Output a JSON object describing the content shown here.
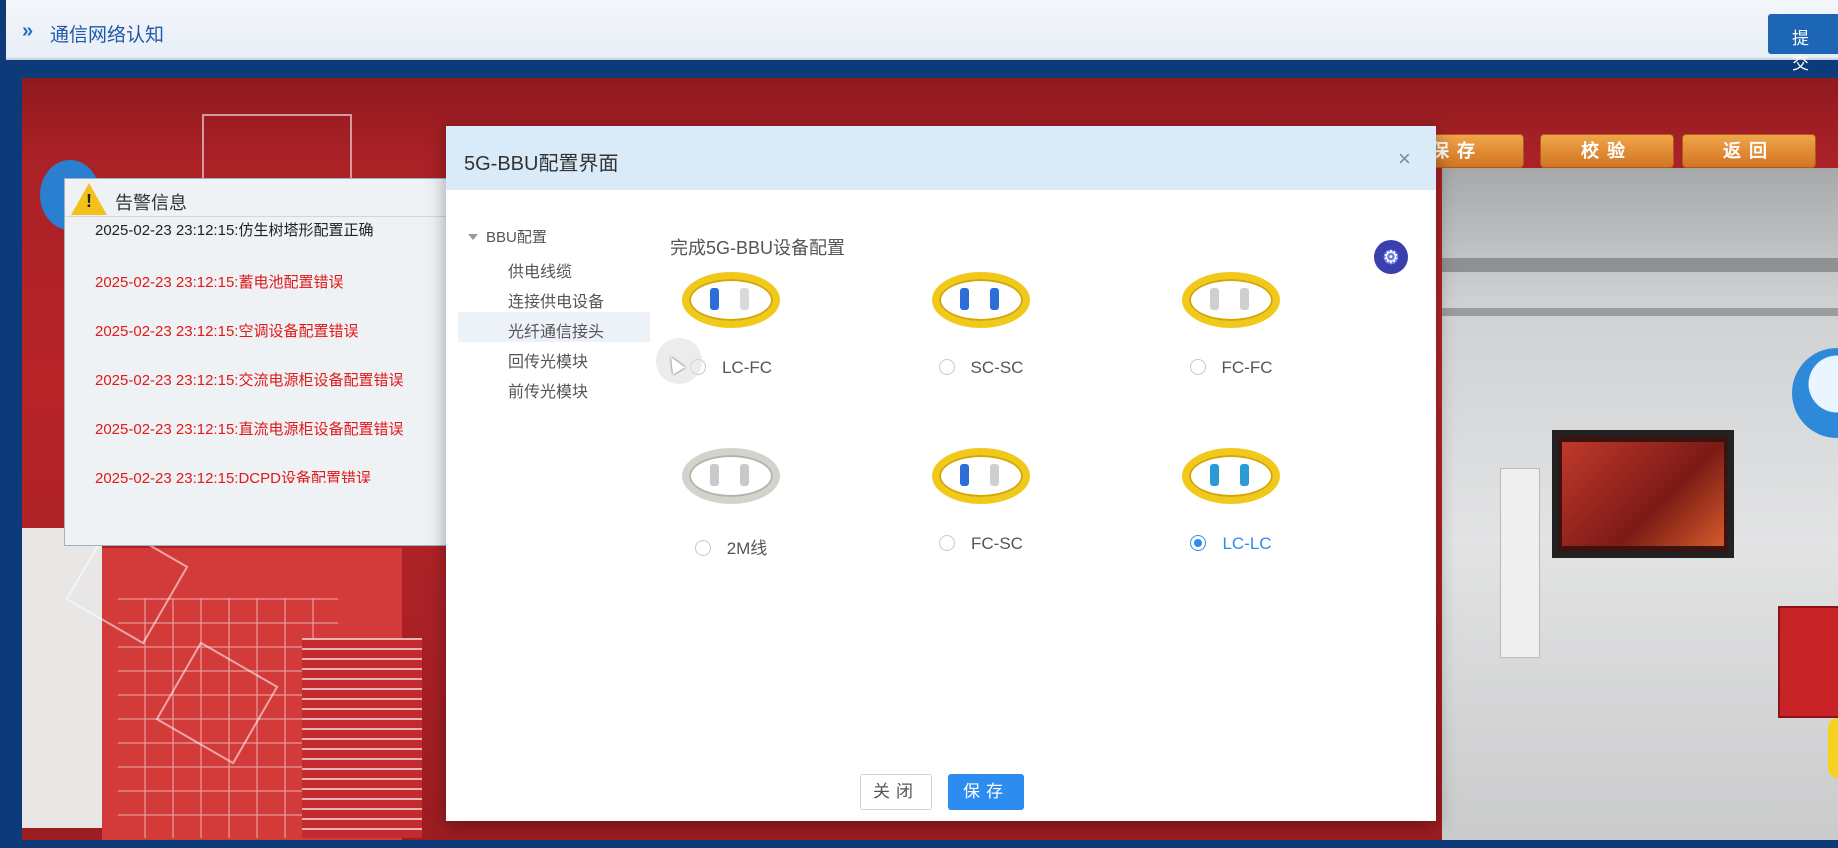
{
  "header": {
    "title": "通信网络认知",
    "submit_label": "提 交"
  },
  "scene_buttons": {
    "save": "保存",
    "check": "校验",
    "back": "返回"
  },
  "alarm": {
    "title": "告警信息",
    "entries": [
      {
        "text": "2025-02-23 23:12:15:仿生树塔形配置正确",
        "status": "ok"
      },
      {
        "text": "2025-02-23 23:12:15:蓄电池配置错误",
        "status": "error"
      },
      {
        "text": "2025-02-23 23:12:15:空调设备配置错误",
        "status": "error"
      },
      {
        "text": "2025-02-23 23:12:15:交流电源柜设备配置错误",
        "status": "error"
      },
      {
        "text": "2025-02-23 23:12:15:直流电源柜设备配置错误",
        "status": "error"
      },
      {
        "text": "2025-02-23 23:12:15:DCPD设备配置错误",
        "status": "error"
      }
    ]
  },
  "modal": {
    "title": "5G-BBU配置界面",
    "close_symbol": "×",
    "tree": {
      "root": "BBU配置",
      "items": [
        {
          "label": "供电线缆",
          "active": false
        },
        {
          "label": "连接供电设备",
          "active": false
        },
        {
          "label": "光纤通信接头",
          "active": true
        },
        {
          "label": "回传光模块",
          "active": false
        },
        {
          "label": "前传光模块",
          "active": false
        }
      ]
    },
    "content_title": "完成5G-BBU设备配置",
    "options": [
      {
        "label": "LC-FC",
        "selected": false,
        "cable_color": "#f1c91b",
        "tip_a": "#2b6fd6",
        "tip_b": "#d9d9d9"
      },
      {
        "label": "SC-SC",
        "selected": false,
        "cable_color": "#f1c91b",
        "tip_a": "#2b6fd6",
        "tip_b": "#2b6fd6"
      },
      {
        "label": "FC-FC",
        "selected": false,
        "cable_color": "#f1c91b",
        "tip_a": "#cfcfcf",
        "tip_b": "#cfcfcf"
      },
      {
        "label": "2M线",
        "selected": false,
        "cable_color": "#d4d2cc",
        "tip_a": "#c9c9c9",
        "tip_b": "#c9c9c9"
      },
      {
        "label": "FC-SC",
        "selected": false,
        "cable_color": "#f1c91b",
        "tip_a": "#2b6fd6",
        "tip_b": "#cfcfcf"
      },
      {
        "label": "LC-LC",
        "selected": true,
        "cable_color": "#f1c91b",
        "tip_a": "#2b9ad6",
        "tip_b": "#2b9ad6"
      }
    ],
    "close_button": "关闭",
    "save_button": "保存"
  },
  "colors": {
    "accent": "#2d8cf0",
    "error": "#e01919",
    "modal_header": "#d9ebf9",
    "scene_button": "#e08a33"
  }
}
